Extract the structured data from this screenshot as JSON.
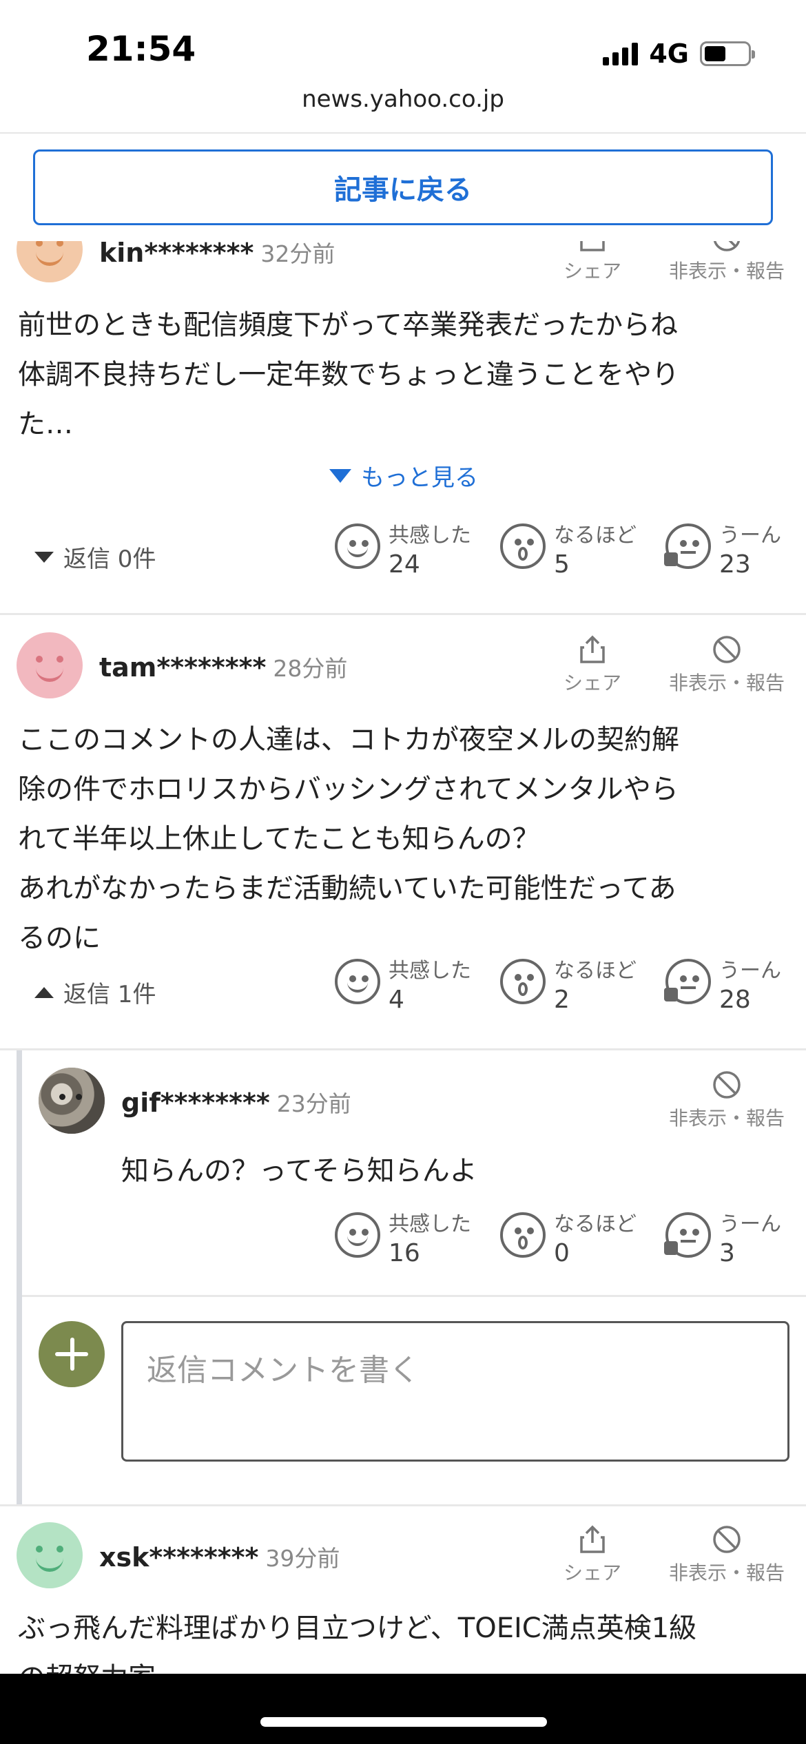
{
  "status_bar": {
    "time": "21:54",
    "network": "4G",
    "battery_level": 0.5
  },
  "browser": {
    "url": "news.yahoo.co.jp"
  },
  "back_button": {
    "label": "記事に戻る"
  },
  "action_labels": {
    "share": "シェア",
    "hide_report": "非表示・報告"
  },
  "reaction_labels": {
    "agree": "共感した",
    "interesting": "なるほど",
    "hmm": "うーん"
  },
  "comments": [
    {
      "user": "kin********",
      "time": "32分前",
      "text_lines": [
        "前世のときも配信頻度下がって卒業発表だったからね",
        "体調不良持ちだし一定年数でちょっと違うことをやり",
        "た…"
      ],
      "more_label": "もっと見る",
      "replies_label": "返信 0件",
      "reactions": {
        "agree": "24",
        "interesting": "5",
        "hmm": "23"
      },
      "avatar_color": "#f3c9a8",
      "face_color": "#d98a52"
    },
    {
      "user": "tam********",
      "time": "28分前",
      "text_lines": [
        "ここのコメントの人達は、コトカが夜空メルの契約解",
        "除の件でホロリスからバッシングされてメンタルやら",
        "れて半年以上休止してたことも知らんの？",
        "あれがなかったらまだ活動続いていた可能性だってあ",
        "るのに"
      ],
      "replies_label": "返信 1件",
      "reactions": {
        "agree": "4",
        "interesting": "2",
        "hmm": "28"
      },
      "avatar_color": "#f2b8bf",
      "face_color": "#d9747f"
    },
    {
      "user": "xsk********",
      "time": "39分前",
      "text_lines": [
        "ぶっ飛んだ料理ばかり目立つけど、TOEIC満点英検1級",
        "の超努力家"
      ],
      "avatar_color": "#b4e3c4",
      "face_color": "#4fae7a"
    }
  ],
  "reply": {
    "user": "gif********",
    "time": "23分前",
    "text": "知らんの？ってそら知らんよ",
    "reactions": {
      "agree": "16",
      "interesting": "0",
      "hmm": "3"
    }
  },
  "reply_input": {
    "placeholder": "返信コメントを書く"
  }
}
